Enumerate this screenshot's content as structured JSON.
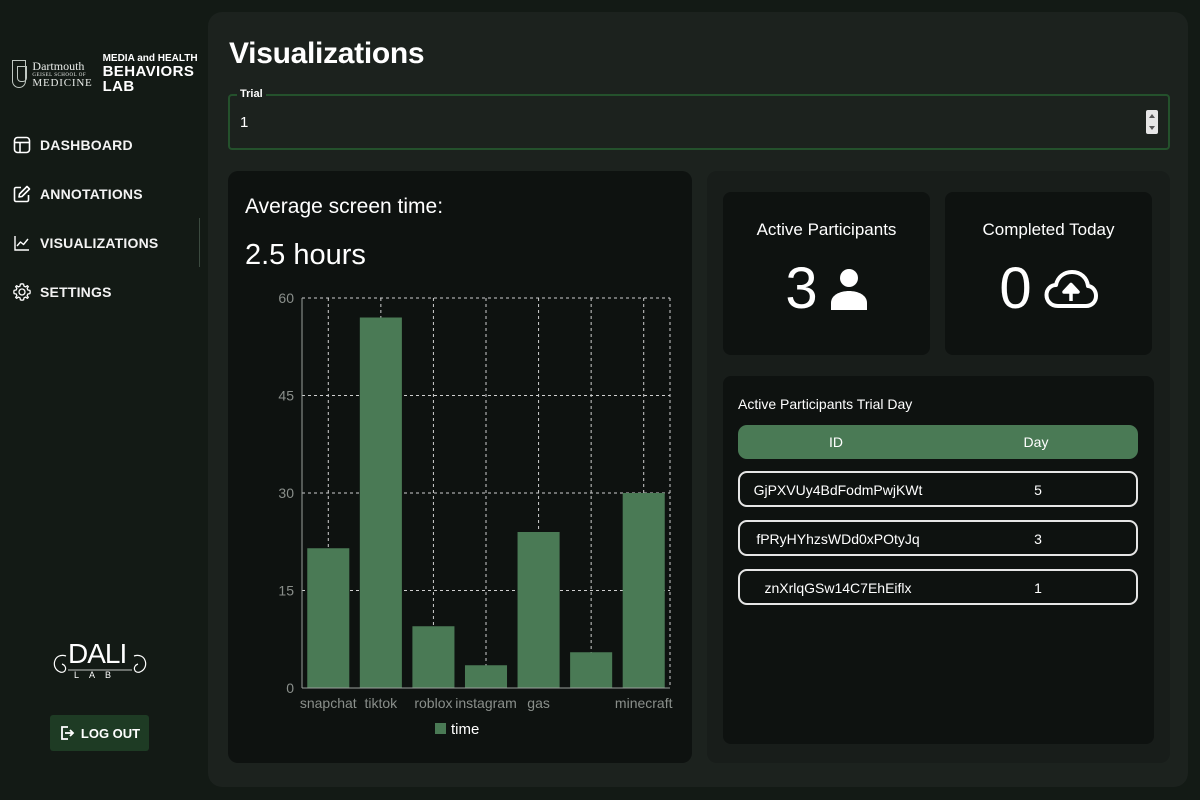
{
  "sidebar": {
    "logo": {
      "dartmouth": "Dartmouth",
      "school": "GEISEL SCHOOL OF",
      "medicine": "MEDICINE",
      "lab_line1": "MEDIA and HEALTH",
      "lab_line2": "BEHAVIORS LAB"
    },
    "nav": [
      {
        "label": "DASHBOARD",
        "icon": "dashboard-icon"
      },
      {
        "label": "ANNOTATIONS",
        "icon": "edit-icon"
      },
      {
        "label": "VISUALIZATIONS",
        "icon": "chart-line-icon",
        "active": true
      },
      {
        "label": "SETTINGS",
        "icon": "gear-icon"
      }
    ],
    "dali": {
      "main": "DALI",
      "sub": "LAB"
    },
    "logout_label": "LOG OUT"
  },
  "main": {
    "title": "Visualizations",
    "trial": {
      "label": "Trial",
      "value": "1"
    },
    "chart_card": {
      "avg_label": "Average screen time:",
      "avg_value": "2.5 hours"
    },
    "stats": [
      {
        "label": "Active Participants",
        "value": "3",
        "icon": "person-icon"
      },
      {
        "label": "Completed Today",
        "value": "0",
        "icon": "cloud-upload-icon"
      }
    ],
    "table": {
      "title": "Active Participants Trial Day",
      "columns": [
        "ID",
        "Day"
      ],
      "rows": [
        {
          "id": "GjPXVUy4BdFodmPwjKWt",
          "day": "5"
        },
        {
          "id": "fPRyHYhzsWDd0xPOtyJq",
          "day": "3"
        },
        {
          "id": "znXrlqGSw14C7EhEiflx",
          "day": "1"
        }
      ]
    }
  },
  "colors": {
    "bar": "#4a7a55",
    "accent": "#24512c",
    "background": "#131a15",
    "card": "#0e1210"
  },
  "chart_data": {
    "type": "bar",
    "categories": [
      "snapchat",
      "tiktok",
      "roblox",
      "instagram",
      "gas",
      "",
      "minecraft"
    ],
    "series": [
      {
        "name": "time",
        "values": [
          21.5,
          57,
          9.5,
          3.5,
          24,
          5.5,
          30
        ]
      }
    ],
    "yticks": [
      0,
      15,
      30,
      45,
      60
    ],
    "ylim": [
      0,
      60
    ],
    "grid": true,
    "legend": "bottom"
  }
}
